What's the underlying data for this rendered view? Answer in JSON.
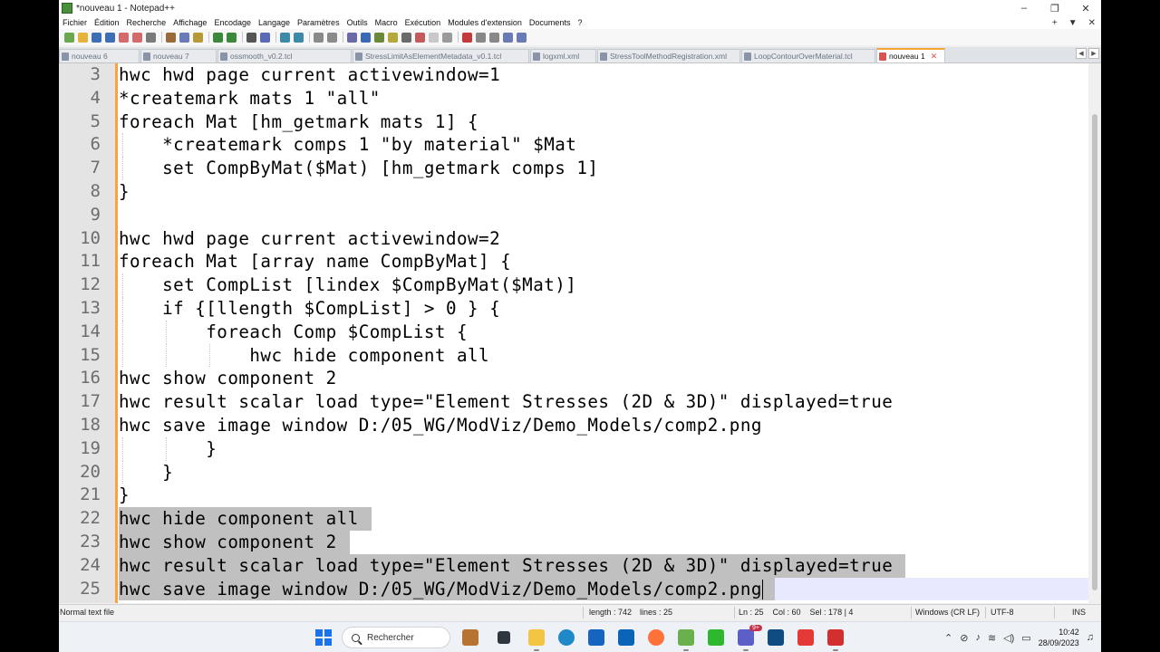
{
  "window": {
    "title": "*nouveau 1 - Notepad++",
    "controls": [
      "–",
      "❐",
      "✕"
    ]
  },
  "menu": {
    "items": [
      "Fichier",
      "Édition",
      "Recherche",
      "Affichage",
      "Encodage",
      "Langage",
      "Paramètres",
      "Outils",
      "Macro",
      "Exécution",
      "Modules d'extension",
      "Documents",
      "?"
    ],
    "right": [
      "+",
      "▼",
      "✕"
    ]
  },
  "tabs": [
    {
      "label": "nouveau 6",
      "active": false
    },
    {
      "label": "nouveau 7",
      "active": false
    },
    {
      "label": "ossmooth_v0.2.tcl",
      "active": false
    },
    {
      "label": "StressLimitAsElementMetadata_v0.1.tcl",
      "active": false
    },
    {
      "label": "logxml.xml",
      "active": false
    },
    {
      "label": "StressToolMethodRegistration.xml",
      "active": false
    },
    {
      "label": "LoopContourOverMaterial.tcl",
      "active": false
    },
    {
      "label": "nouveau 1",
      "active": true
    }
  ],
  "tab_arrows": [
    "◀",
    "▶"
  ],
  "editor": {
    "lines": [
      {
        "n": "3",
        "text": "hwc hwd page current activewindow=1",
        "sel": false
      },
      {
        "n": "4",
        "text": "*createmark mats 1 \"all\"",
        "sel": false
      },
      {
        "n": "5",
        "text": "foreach Mat [hm_getmark mats 1] {",
        "sel": false
      },
      {
        "n": "6",
        "text": "    *createmark comps 1 \"by material\" $Mat",
        "sel": false
      },
      {
        "n": "7",
        "text": "    set CompByMat($Mat) [hm_getmark comps 1]",
        "sel": false
      },
      {
        "n": "8",
        "text": "}",
        "sel": false
      },
      {
        "n": "9",
        "text": "",
        "sel": false
      },
      {
        "n": "10",
        "text": "hwc hwd page current activewindow=2",
        "sel": false
      },
      {
        "n": "11",
        "text": "foreach Mat [array name CompByMat] {",
        "sel": false
      },
      {
        "n": "12",
        "text": "    set CompList [lindex $CompByMat($Mat)]",
        "sel": false
      },
      {
        "n": "13",
        "text": "    if {[llength $CompList] > 0 } {",
        "sel": false
      },
      {
        "n": "14",
        "text": "        foreach Comp $CompList {",
        "sel": false
      },
      {
        "n": "15",
        "text": "            hwc hide component all",
        "sel": false
      },
      {
        "n": "16",
        "text": "hwc show component 2",
        "sel": false
      },
      {
        "n": "17",
        "text": "hwc result scalar load type=\"Element Stresses (2D & 3D)\" displayed=true",
        "sel": false
      },
      {
        "n": "18",
        "text": "hwc save image window D:/05_WG/ModViz/Demo_Models/comp2.png",
        "sel": false
      },
      {
        "n": "19",
        "text": "        }",
        "sel": false
      },
      {
        "n": "20",
        "text": "    }",
        "sel": false
      },
      {
        "n": "21",
        "text": "}",
        "sel": false
      },
      {
        "n": "22",
        "text": "hwc hide component all",
        "sel": true
      },
      {
        "n": "23",
        "text": "hwc show component 2",
        "sel": true
      },
      {
        "n": "24",
        "text": "hwc result scalar load type=\"Element Stresses (2D & 3D)\" displayed=true",
        "sel": true
      },
      {
        "n": "25",
        "text": "hwc save image window D:/05_WG/ModViz/Demo_Models/comp2.png",
        "sel": true
      }
    ]
  },
  "status": {
    "file_type": "Normal text file",
    "length": "length : 742",
    "lines": "lines : 25",
    "position": "Ln : 25    Col : 60    Sel : 178 | 4",
    "eol": "Windows (CR LF)",
    "encoding": "UTF-8",
    "mode": "INS"
  },
  "taskbar": {
    "search_label": "Rechercher",
    "teams_badge": "9+",
    "time": "10:42",
    "date": "28/09/2023"
  },
  "colors": {
    "accent": "#f7a43a",
    "selection": "#c0c0c0",
    "gutter": "#e4e4e4"
  }
}
